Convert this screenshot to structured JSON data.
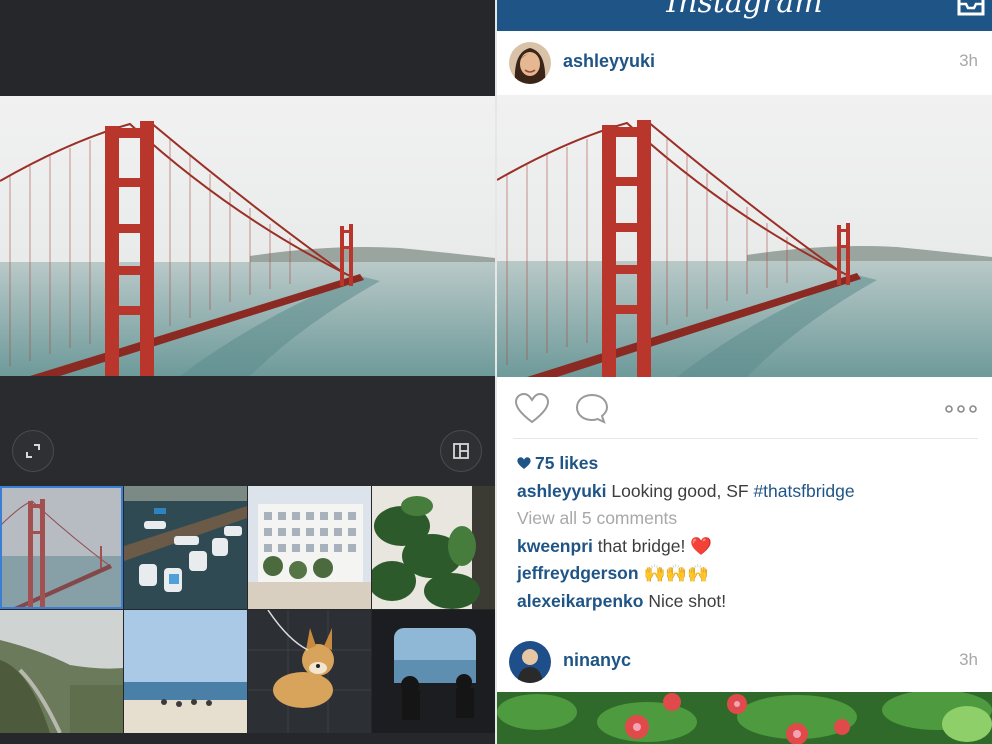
{
  "feed": {
    "app_title": "Instagram",
    "post1": {
      "username": "ashleyyuki",
      "time": "3h",
      "likes": "75 likes",
      "caption_user": "ashleyyuki",
      "caption_text": "Looking good, SF",
      "caption_hashtag": "#thatsfbridge",
      "view_comments": "View all 5 comments",
      "comments": [
        {
          "user": "kweenpri",
          "text": "that bridge!",
          "emoji": "❤️"
        },
        {
          "user": "jeffreydgerson",
          "text": "",
          "emoji": "🙌🙌🙌"
        },
        {
          "user": "alexeikarpenko",
          "text": "Nice shot!",
          "emoji": ""
        }
      ]
    },
    "post2": {
      "username": "ninanyc",
      "time": "3h"
    }
  },
  "icons": {
    "expand": "expand-icon",
    "layout": "layout-icon",
    "heart": "heart-icon",
    "comment": "comment-icon",
    "more": "more-icon",
    "inbox": "inbox-icon"
  },
  "colors": {
    "brand_blue": "#1f5586",
    "editor_dark": "#26272b",
    "selection": "#3a7fd4",
    "bridge_red": "#b8362c",
    "heart_red": "#e0262c"
  }
}
